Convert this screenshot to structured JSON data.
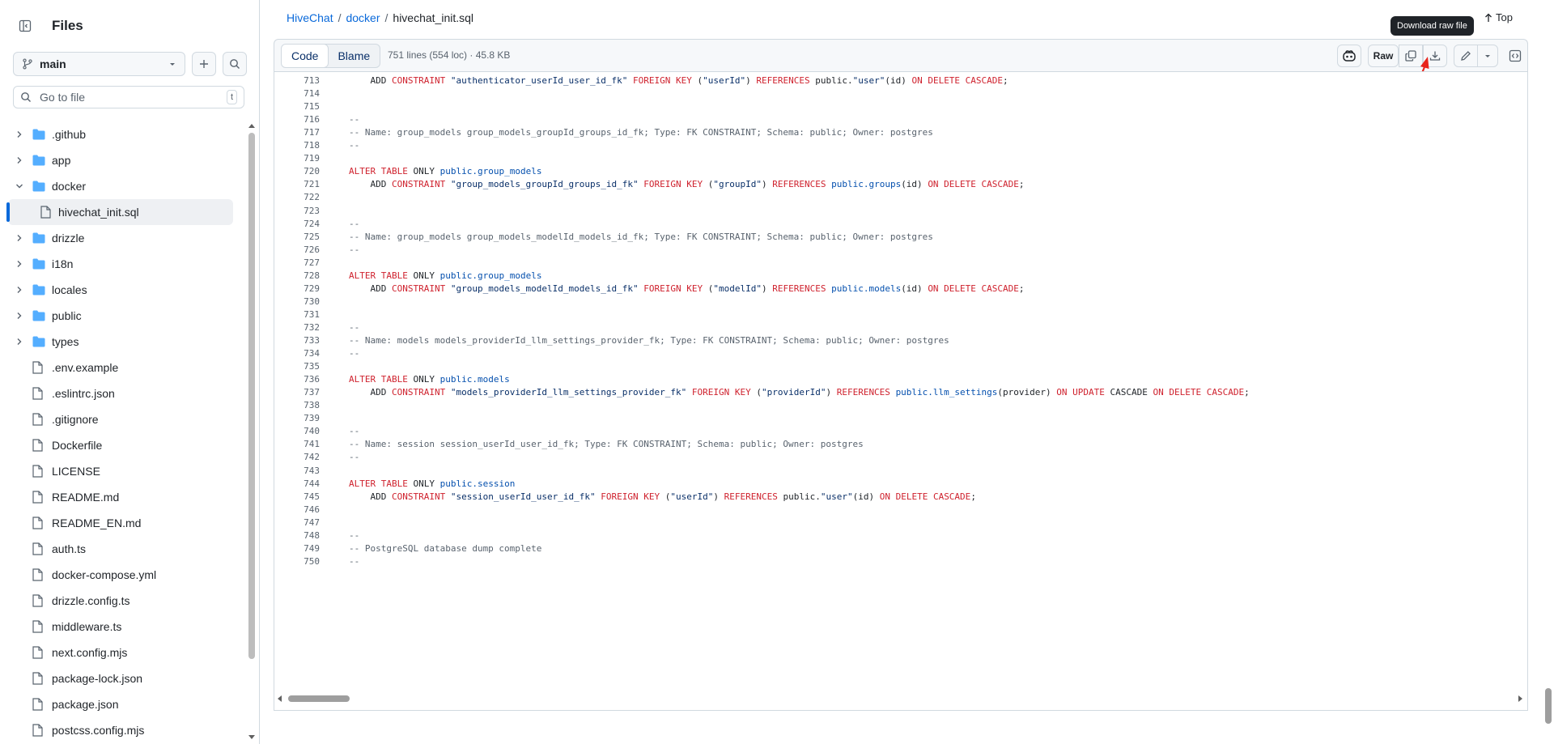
{
  "sidebar": {
    "title": "Files",
    "branch": "main",
    "goto_placeholder": "Go to file",
    "goto_shortcut": "t",
    "items": [
      {
        "label": ".github",
        "type": "folder",
        "expanded": false,
        "depth": 0
      },
      {
        "label": "app",
        "type": "folder",
        "expanded": false,
        "depth": 0
      },
      {
        "label": "docker",
        "type": "folder",
        "expanded": true,
        "depth": 0
      },
      {
        "label": "hivechat_init.sql",
        "type": "file",
        "selected": true,
        "depth": 1
      },
      {
        "label": "drizzle",
        "type": "folder",
        "expanded": false,
        "depth": 0
      },
      {
        "label": "i18n",
        "type": "folder",
        "expanded": false,
        "depth": 0
      },
      {
        "label": "locales",
        "type": "folder",
        "expanded": false,
        "depth": 0
      },
      {
        "label": "public",
        "type": "folder",
        "expanded": false,
        "depth": 0
      },
      {
        "label": "types",
        "type": "folder",
        "expanded": false,
        "depth": 0
      },
      {
        "label": ".env.example",
        "type": "file",
        "depth": 0
      },
      {
        "label": ".eslintrc.json",
        "type": "file",
        "depth": 0
      },
      {
        "label": ".gitignore",
        "type": "file",
        "depth": 0
      },
      {
        "label": "Dockerfile",
        "type": "file",
        "depth": 0
      },
      {
        "label": "LICENSE",
        "type": "file",
        "depth": 0
      },
      {
        "label": "README.md",
        "type": "file",
        "depth": 0
      },
      {
        "label": "README_EN.md",
        "type": "file",
        "depth": 0
      },
      {
        "label": "auth.ts",
        "type": "file",
        "depth": 0
      },
      {
        "label": "docker-compose.yml",
        "type": "file",
        "depth": 0
      },
      {
        "label": "drizzle.config.ts",
        "type": "file",
        "depth": 0
      },
      {
        "label": "middleware.ts",
        "type": "file",
        "depth": 0
      },
      {
        "label": "next.config.mjs",
        "type": "file",
        "depth": 0
      },
      {
        "label": "package-lock.json",
        "type": "file",
        "depth": 0
      },
      {
        "label": "package.json",
        "type": "file",
        "depth": 0
      },
      {
        "label": "postcss.config.mjs",
        "type": "file",
        "depth": 0
      }
    ]
  },
  "breadcrumb": {
    "repo": "HiveChat",
    "folder": "docker",
    "sep": "/",
    "file": "hivechat_init.sql"
  },
  "top_link": "Top",
  "tooltip": "Download raw file",
  "toolbar": {
    "code_tab": "Code",
    "blame_tab": "Blame",
    "meta": "751 lines (554 loc) · 45.8 KB",
    "raw_label": "Raw"
  },
  "code": [
    {
      "n": "713",
      "t": [
        [
          "",
          "    ADD "
        ],
        [
          "k",
          "CONSTRAINT "
        ],
        [
          "s",
          "\"authenticator_userId_user_id_fk\" "
        ],
        [
          "k",
          "FOREIGN KEY "
        ],
        [
          "",
          "("
        ],
        [
          "s",
          "\"userId\""
        ],
        [
          "",
          ") "
        ],
        [
          "k",
          "REFERENCES "
        ],
        [
          "",
          "public."
        ],
        [
          "s",
          "\"user\""
        ],
        [
          "",
          "(id) "
        ],
        [
          "k",
          "ON DELETE CASCADE"
        ],
        [
          "",
          ";"
        ]
      ]
    },
    {
      "n": "714",
      "t": []
    },
    {
      "n": "715",
      "t": []
    },
    {
      "n": "716",
      "t": [
        [
          "c",
          "--"
        ]
      ]
    },
    {
      "n": "717",
      "t": [
        [
          "c",
          "-- Name: group_models group_models_groupId_groups_id_fk; Type: FK CONSTRAINT; Schema: public; Owner: postgres"
        ]
      ]
    },
    {
      "n": "718",
      "t": [
        [
          "c",
          "--"
        ]
      ]
    },
    {
      "n": "719",
      "t": []
    },
    {
      "n": "720",
      "t": [
        [
          "k",
          "ALTER TABLE "
        ],
        [
          "",
          "ONLY "
        ],
        [
          "f",
          "public.group_models"
        ]
      ]
    },
    {
      "n": "721",
      "t": [
        [
          "",
          "    ADD "
        ],
        [
          "k",
          "CONSTRAINT "
        ],
        [
          "s",
          "\"group_models_groupId_groups_id_fk\" "
        ],
        [
          "k",
          "FOREIGN KEY "
        ],
        [
          "",
          "("
        ],
        [
          "s",
          "\"groupId\""
        ],
        [
          "",
          ") "
        ],
        [
          "k",
          "REFERENCES "
        ],
        [
          "f",
          "public.groups"
        ],
        [
          "",
          "(id) "
        ],
        [
          "k",
          "ON DELETE CASCADE"
        ],
        [
          "",
          ";"
        ]
      ]
    },
    {
      "n": "722",
      "t": []
    },
    {
      "n": "723",
      "t": []
    },
    {
      "n": "724",
      "t": [
        [
          "c",
          "--"
        ]
      ]
    },
    {
      "n": "725",
      "t": [
        [
          "c",
          "-- Name: group_models group_models_modelId_models_id_fk; Type: FK CONSTRAINT; Schema: public; Owner: postgres"
        ]
      ]
    },
    {
      "n": "726",
      "t": [
        [
          "c",
          "--"
        ]
      ]
    },
    {
      "n": "727",
      "t": []
    },
    {
      "n": "728",
      "t": [
        [
          "k",
          "ALTER TABLE "
        ],
        [
          "",
          "ONLY "
        ],
        [
          "f",
          "public.group_models"
        ]
      ]
    },
    {
      "n": "729",
      "t": [
        [
          "",
          "    ADD "
        ],
        [
          "k",
          "CONSTRAINT "
        ],
        [
          "s",
          "\"group_models_modelId_models_id_fk\" "
        ],
        [
          "k",
          "FOREIGN KEY "
        ],
        [
          "",
          "("
        ],
        [
          "s",
          "\"modelId\""
        ],
        [
          "",
          ") "
        ],
        [
          "k",
          "REFERENCES "
        ],
        [
          "f",
          "public.models"
        ],
        [
          "",
          "(id) "
        ],
        [
          "k",
          "ON DELETE CASCADE"
        ],
        [
          "",
          ";"
        ]
      ]
    },
    {
      "n": "730",
      "t": []
    },
    {
      "n": "731",
      "t": []
    },
    {
      "n": "732",
      "t": [
        [
          "c",
          "--"
        ]
      ]
    },
    {
      "n": "733",
      "t": [
        [
          "c",
          "-- Name: models models_providerId_llm_settings_provider_fk; Type: FK CONSTRAINT; Schema: public; Owner: postgres"
        ]
      ]
    },
    {
      "n": "734",
      "t": [
        [
          "c",
          "--"
        ]
      ]
    },
    {
      "n": "735",
      "t": []
    },
    {
      "n": "736",
      "t": [
        [
          "k",
          "ALTER TABLE "
        ],
        [
          "",
          "ONLY "
        ],
        [
          "f",
          "public.models"
        ]
      ]
    },
    {
      "n": "737",
      "t": [
        [
          "",
          "    ADD "
        ],
        [
          "k",
          "CONSTRAINT "
        ],
        [
          "s",
          "\"models_providerId_llm_settings_provider_fk\" "
        ],
        [
          "k",
          "FOREIGN KEY "
        ],
        [
          "",
          "("
        ],
        [
          "s",
          "\"providerId\""
        ],
        [
          "",
          ") "
        ],
        [
          "k",
          "REFERENCES "
        ],
        [
          "f",
          "public.llm_settings"
        ],
        [
          "",
          "(provider) "
        ],
        [
          "k",
          "ON UPDATE "
        ],
        [
          "",
          "CASCADE "
        ],
        [
          "k",
          "ON DELETE CASCADE"
        ],
        [
          "",
          ";"
        ]
      ]
    },
    {
      "n": "738",
      "t": []
    },
    {
      "n": "739",
      "t": []
    },
    {
      "n": "740",
      "t": [
        [
          "c",
          "--"
        ]
      ]
    },
    {
      "n": "741",
      "t": [
        [
          "c",
          "-- Name: session session_userId_user_id_fk; Type: FK CONSTRAINT; Schema: public; Owner: postgres"
        ]
      ]
    },
    {
      "n": "742",
      "t": [
        [
          "c",
          "--"
        ]
      ]
    },
    {
      "n": "743",
      "t": []
    },
    {
      "n": "744",
      "t": [
        [
          "k",
          "ALTER TABLE "
        ],
        [
          "",
          "ONLY "
        ],
        [
          "f",
          "public.session"
        ]
      ]
    },
    {
      "n": "745",
      "t": [
        [
          "",
          "    ADD "
        ],
        [
          "k",
          "CONSTRAINT "
        ],
        [
          "s",
          "\"session_userId_user_id_fk\" "
        ],
        [
          "k",
          "FOREIGN KEY "
        ],
        [
          "",
          "("
        ],
        [
          "s",
          "\"userId\""
        ],
        [
          "",
          ") "
        ],
        [
          "k",
          "REFERENCES "
        ],
        [
          "",
          "public."
        ],
        [
          "s",
          "\"user\""
        ],
        [
          "",
          "(id) "
        ],
        [
          "k",
          "ON DELETE CASCADE"
        ],
        [
          "",
          ";"
        ]
      ]
    },
    {
      "n": "746",
      "t": []
    },
    {
      "n": "747",
      "t": []
    },
    {
      "n": "748",
      "t": [
        [
          "c",
          "--"
        ]
      ]
    },
    {
      "n": "749",
      "t": [
        [
          "c",
          "-- PostgreSQL database dump complete"
        ]
      ]
    },
    {
      "n": "750",
      "t": [
        [
          "c",
          "--"
        ]
      ]
    }
  ],
  "colors": {
    "accent": "#0969da",
    "keyword": "#cf222e",
    "string": "#0a3069",
    "entity": "#0550ae",
    "comment": "#59636e"
  }
}
